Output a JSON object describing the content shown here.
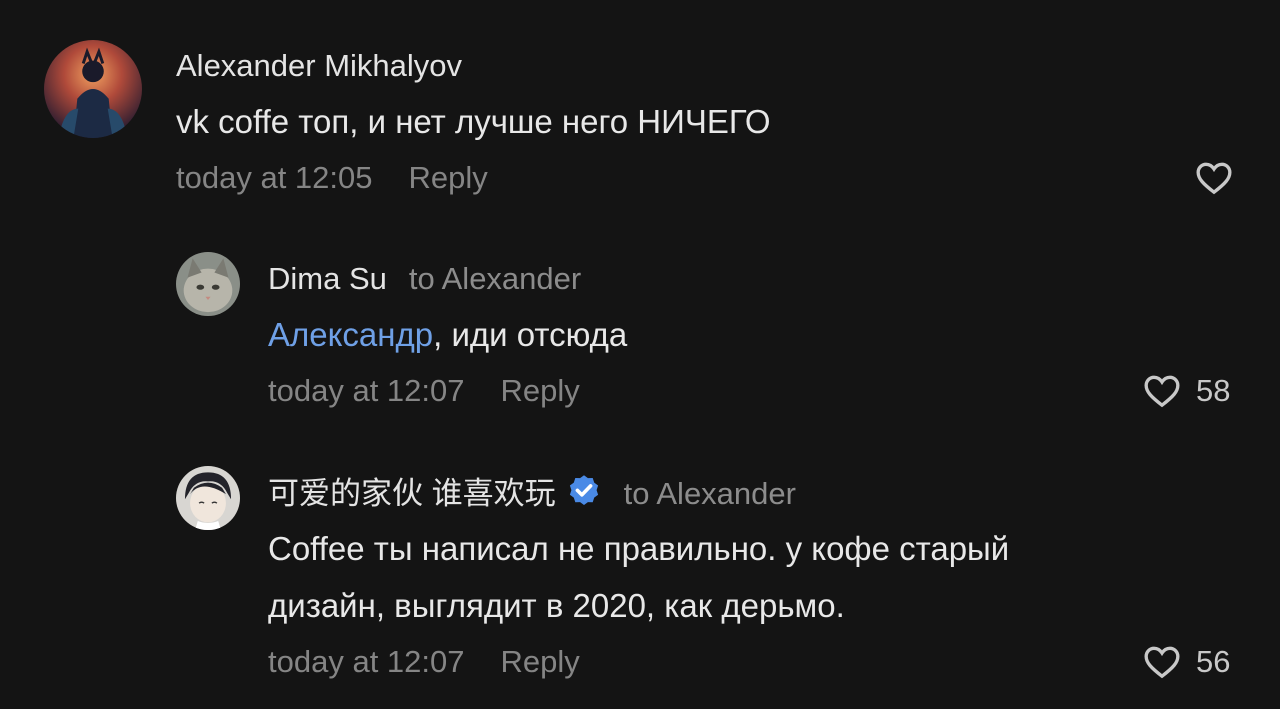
{
  "colors": {
    "background": "#141414",
    "mention": "#6fa0e6",
    "verified": "#4a8ae6",
    "muted": "#858585"
  },
  "comments": [
    {
      "author": "Alexander Mikhalyov",
      "text": "vk coffe топ, и нет лучше него НИЧЕГО",
      "time": "today at 12:05",
      "reply_label": "Reply",
      "likes": ""
    },
    {
      "author": "Dima Su",
      "to": "to Alexander",
      "mention": "Александр",
      "text_rest": ", иди отсюда",
      "time": "today at 12:07",
      "reply_label": "Reply",
      "likes": "58"
    },
    {
      "author": "可爱的家伙 谁喜欢玩",
      "verified_icon": "verified-check-icon",
      "to": "to Alexander",
      "text_line1": "Coffee ты написал не правильно. у кофе старый",
      "text_line2": "дизайн, выглядит в 2020, как дерьмо.",
      "time": "today at 12:07",
      "reply_label": "Reply",
      "likes": "56"
    }
  ]
}
